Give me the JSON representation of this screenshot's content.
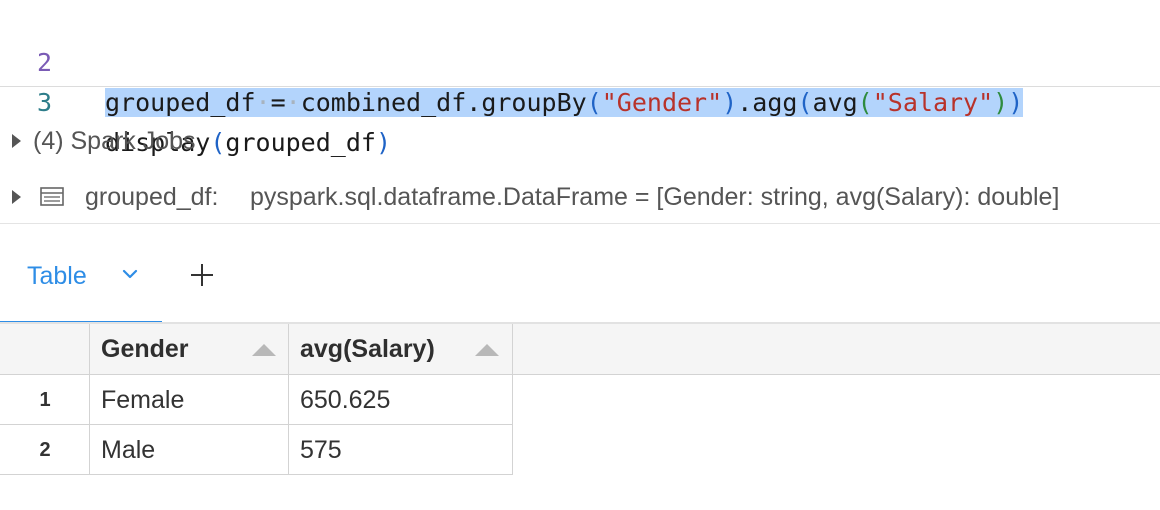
{
  "editor": {
    "lines": [
      {
        "number": "2",
        "tokens": {
          "t1": "grouped_df",
          "t2": "·",
          "t3": "=",
          "t4": "·",
          "t5": "combined_df.groupBy",
          "t6": "(",
          "t7": "\"Gender\"",
          "t8": ")",
          "t9": ".agg",
          "t10": "(",
          "t11": "avg",
          "t12": "(",
          "t13": "\"Salary\"",
          "t14": ")",
          "t15": ")"
        }
      },
      {
        "number": "3",
        "tokens": {
          "t1": "display",
          "t2": "(",
          "t3": "grouped_df",
          "t4": ")"
        }
      }
    ]
  },
  "spark_jobs": {
    "label": "(4) Spark Jobs"
  },
  "dataframe_info": {
    "name": "grouped_df:",
    "schema": "pyspark.sql.dataframe.DataFrame = [Gender: string, avg(Salary): double]"
  },
  "tabs": {
    "active_label": "Table",
    "icons": {
      "dropdown": "chevron-down-icon",
      "add": "plus-icon",
      "expand": "caret-right-icon",
      "dataframe": "table-icon"
    }
  },
  "table": {
    "columns": [
      "Gender",
      "avg(Salary)"
    ],
    "rows": [
      {
        "index": "1",
        "cells": [
          "Female",
          "650.625"
        ]
      },
      {
        "index": "2",
        "cells": [
          "Male",
          "575"
        ]
      }
    ]
  },
  "colors": {
    "accent": "#2e8de6",
    "selection": "#b3d4fc",
    "string": "#b8322a"
  }
}
